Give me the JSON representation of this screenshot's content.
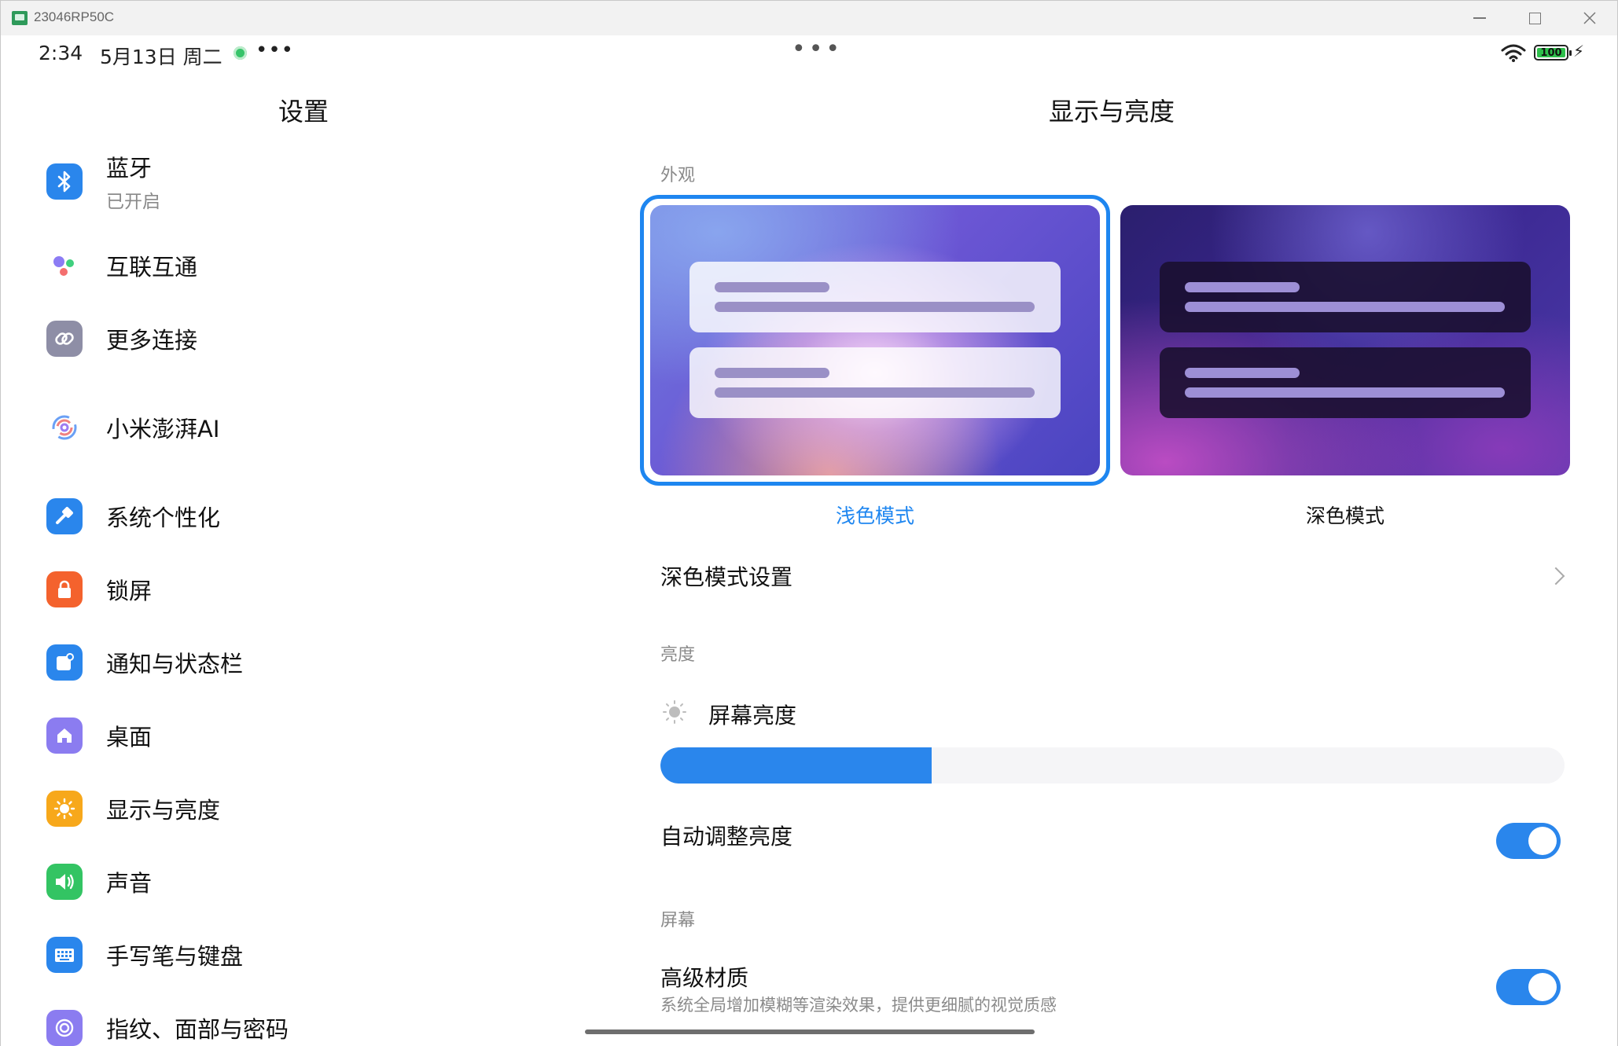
{
  "window": {
    "title": "23046RP50C"
  },
  "status_bar": {
    "time": "2:34",
    "date": "5月13日 周二",
    "more": "•••",
    "center_more": "•••",
    "battery": "100"
  },
  "left_pane": {
    "title": "设置",
    "items": [
      {
        "label": "蓝牙",
        "sub": "已开启",
        "icon": "bluetooth-icon",
        "color": "#2a86ec"
      },
      {
        "label": "互联互通",
        "icon": "interconnect-icon",
        "color": "#ffffff"
      },
      {
        "label": "更多连接",
        "icon": "link-icon",
        "color": "#8e8ea6"
      },
      {
        "label": "小米澎湃AI",
        "icon": "hyper-ai-icon",
        "color": "#ffffff"
      },
      {
        "label": "系统个性化",
        "icon": "brush-icon",
        "color": "#2a86ec"
      },
      {
        "label": "锁屏",
        "icon": "lock-icon",
        "color": "#f4622d"
      },
      {
        "label": "通知与状态栏",
        "icon": "notification-icon",
        "color": "#2a86ec"
      },
      {
        "label": "桌面",
        "icon": "home-icon",
        "color": "#8b7cf0"
      },
      {
        "label": "显示与亮度",
        "icon": "sun-icon",
        "color": "#f7a81b"
      },
      {
        "label": "声音",
        "icon": "speaker-icon",
        "color": "#33c463"
      },
      {
        "label": "手写笔与键盘",
        "icon": "keyboard-icon",
        "color": "#2a86ec"
      },
      {
        "label": "指纹、面部与密码",
        "icon": "fingerprint-icon",
        "color": "#8b7cf0"
      }
    ]
  },
  "right_pane": {
    "title": "显示与亮度",
    "appearance_section": "外观",
    "light_mode_label": "浅色模式",
    "dark_mode_label": "深色模式",
    "selected_mode": "浅色模式",
    "dark_mode_settings": "深色模式设置",
    "brightness_section": "亮度",
    "screen_brightness_label": "屏幕亮度",
    "brightness_level": 0.3,
    "auto_brightness_label": "自动调整亮度",
    "auto_brightness_on": true,
    "screen_section": "屏幕",
    "advanced_material_label": "高级材质",
    "advanced_material_sub": "系统全局增加模糊等渲染效果，提供更细腻的视觉质感",
    "advanced_material_on": true
  },
  "colors": {
    "accent": "#1e86f0",
    "toggle_on": "#2a86ec"
  }
}
